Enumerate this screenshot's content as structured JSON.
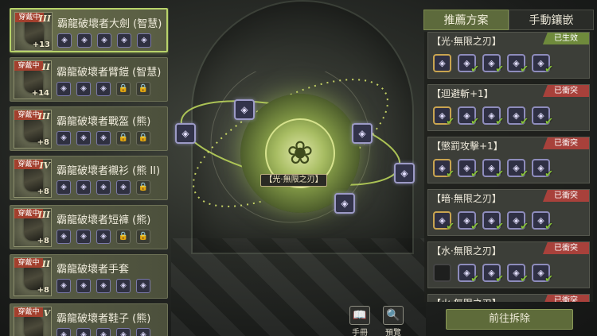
{
  "equipment": [
    {
      "tag": "穿戴中",
      "tier": "III",
      "plus": "+13",
      "name": "霸龍破壞者大劍 (智慧)",
      "slots": [
        "◈",
        "◈",
        "◈",
        "◈",
        "◈"
      ],
      "locked": [
        false,
        false,
        false,
        false,
        false
      ],
      "selected": true
    },
    {
      "tag": "穿戴中",
      "tier": "II",
      "plus": "+14",
      "name": "霸龍破壞者臂鎧 (智慧)",
      "slots": [
        "◈",
        "◈",
        "◈",
        "🔒",
        "🔒"
      ],
      "locked": [
        false,
        false,
        false,
        true,
        true
      ],
      "selected": false
    },
    {
      "tag": "穿戴中",
      "tier": "III",
      "plus": "+8",
      "name": "霸龍破壞者戰盔 (熊)",
      "slots": [
        "◈",
        "◈",
        "◈",
        "🔒",
        "🔒"
      ],
      "locked": [
        false,
        false,
        false,
        true,
        true
      ],
      "selected": false
    },
    {
      "tag": "穿戴中",
      "tier": "IV",
      "plus": "+8",
      "name": "霸龍破壞者襯衫 (熊 II)",
      "slots": [
        "◈",
        "◈",
        "◈",
        "◈",
        "🔒"
      ],
      "locked": [
        false,
        false,
        false,
        false,
        true
      ],
      "selected": false
    },
    {
      "tag": "穿戴中",
      "tier": "III",
      "plus": "+8",
      "name": "霸龍破壞者短褲 (熊)",
      "slots": [
        "◈",
        "◈",
        "◈",
        "🔒",
        "🔒"
      ],
      "locked": [
        false,
        false,
        false,
        true,
        true
      ],
      "selected": false
    },
    {
      "tag": "穿戴中",
      "tier": "II",
      "plus": "+8",
      "name": "霸龍破壞者手套",
      "slots": [
        "◈",
        "◈",
        "◈",
        "◈",
        "◈"
      ],
      "locked": [
        false,
        false,
        false,
        false,
        false
      ],
      "selected": false
    },
    {
      "tag": "穿戴中",
      "tier": "V",
      "plus": "",
      "name": "霸龍破壞者鞋子 (熊)",
      "slots": [
        "◈",
        "◈",
        "◈",
        "◈",
        "◈"
      ],
      "locked": [
        false,
        false,
        false,
        false,
        false
      ],
      "selected": false
    }
  ],
  "center": {
    "label": "【光·無限之刃】",
    "emblem_icon": "❀",
    "node_icon": "◈"
  },
  "bottom_buttons": [
    {
      "icon": "📖",
      "label": "手冊"
    },
    {
      "icon": "🔍",
      "label": "預覽"
    }
  ],
  "tabs": [
    {
      "label": "推薦方案",
      "active": true
    },
    {
      "label": "手動鑲嵌",
      "active": false
    }
  ],
  "plans": [
    {
      "title": "【光·無限之刃】",
      "status": "已生效",
      "status_type": "ok"
    },
    {
      "title": "【迴避斬+1】",
      "status": "已衝突",
      "status_type": "conflict"
    },
    {
      "title": "【懲罰攻擊+1】",
      "status": "已衝突",
      "status_type": "conflict"
    },
    {
      "title": "【暗·無限之刃】",
      "status": "已衝突",
      "status_type": "conflict"
    },
    {
      "title": "【水·無限之刃】",
      "status": "已衝突",
      "status_type": "conflict"
    },
    {
      "title": "【火·無限之刃】",
      "status": "已衝突",
      "status_type": "conflict"
    }
  ],
  "go_button": "前往拆除"
}
